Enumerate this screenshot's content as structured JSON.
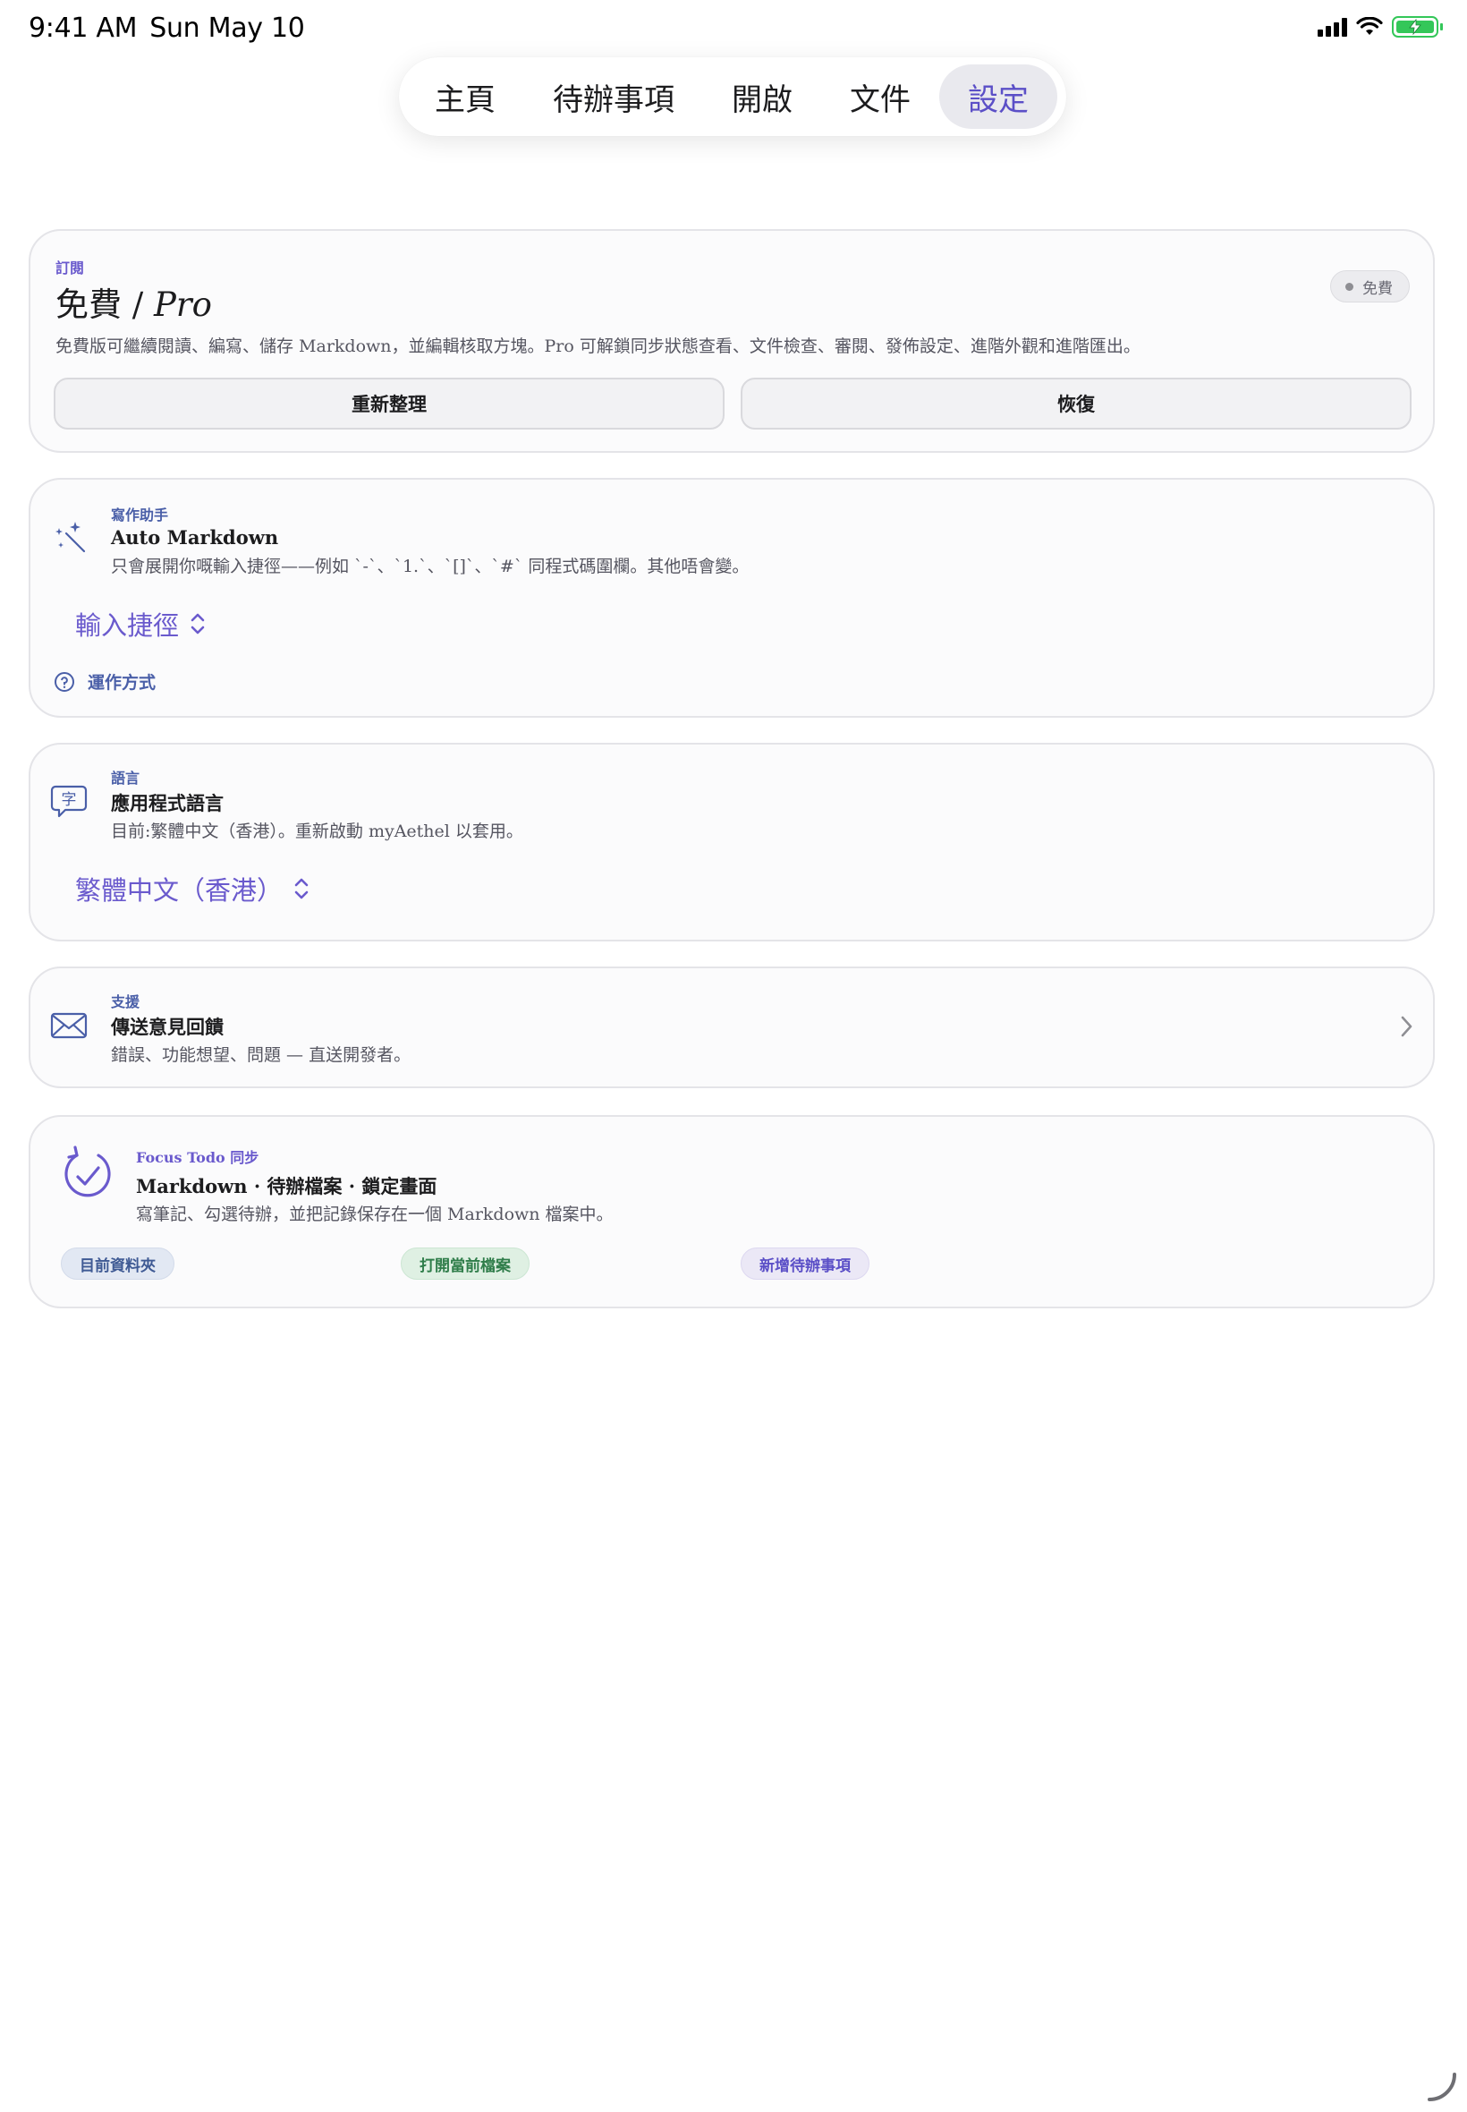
{
  "status_bar": {
    "time": "9:41 AM",
    "date": "Sun May 10",
    "icons": [
      "cellular-signal-icon",
      "wifi-icon",
      "battery-charging-icon"
    ]
  },
  "nav": {
    "tabs": [
      {
        "label": "主頁",
        "active": false
      },
      {
        "label": "待辦事項",
        "active": false
      },
      {
        "label": "開啟",
        "active": false
      },
      {
        "label": "文件",
        "active": false
      },
      {
        "label": "設定",
        "active": true
      }
    ]
  },
  "subscription": {
    "kicker": "訂閱",
    "title_free": "免費",
    "title_sep": " / ",
    "title_pro": "Pro",
    "badge": "免費",
    "description": "免費版可繼續閱讀、編寫、儲存 Markdown，並編輯核取方塊。Pro 可解鎖同步狀態查看、文件檢查、審閱、發佈設定、進階外觀和進階匯出。",
    "refresh_label": "重新整理",
    "restore_label": "恢復"
  },
  "writing": {
    "kicker": "寫作助手",
    "title": "Auto Markdown",
    "description": "只會展開你嘅輸入捷徑——例如 `-`、`1.`、`[]`、`#` 同程式碼圍欄。其他唔會變。",
    "picker_label": "輸入捷徑",
    "how_label": "運作方式"
  },
  "language": {
    "kicker": "語言",
    "title": "應用程式語言",
    "description": "目前:繁體中文（香港）。重新啟動 myAethel 以套用。",
    "picker_label": "繁體中文（香港）"
  },
  "support": {
    "kicker": "支援",
    "title": "傳送意見回饋",
    "description": "錯誤、功能想望、問題 — 直送開發者。"
  },
  "focus": {
    "kicker": "Focus Todo 同步",
    "title": "Markdown · 待辦檔案 · 鎖定畫面",
    "description": "寫筆記、勾選待辦，並把記錄保存在一個 Markdown 檔案中。",
    "chips": [
      "目前資料夾",
      "打開當前檔案",
      "新增待辦事項"
    ]
  },
  "colors": {
    "accent": "#6a5acd",
    "blue_label": "#4a5fa8",
    "battery": "#34c759",
    "card_border": "#e4e4e8"
  }
}
